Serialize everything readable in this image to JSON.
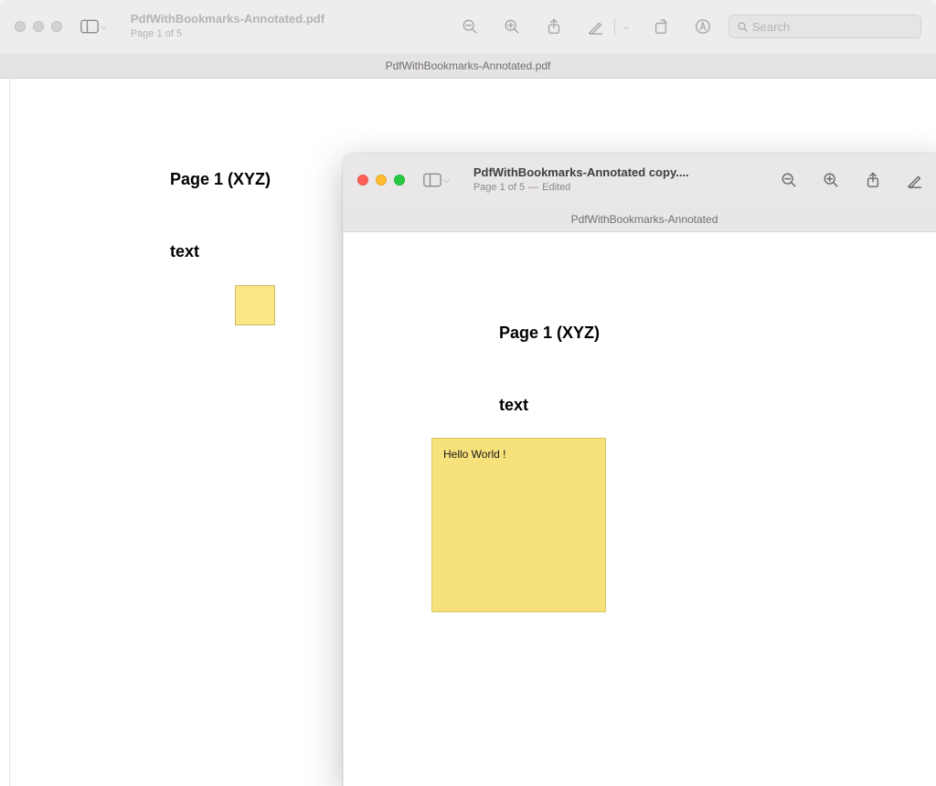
{
  "window1": {
    "title": "PdfWithBookmarks-Annotated.pdf",
    "page_indicator": "Page 1 of 5",
    "tab_label": "PdfWithBookmarks-Annotated.pdf",
    "search_placeholder": "Search",
    "content": {
      "heading": "Page 1 (XYZ)",
      "body": "text"
    }
  },
  "window2": {
    "title": "PdfWithBookmarks-Annotated copy....",
    "page_indicator": "Page 1 of 5",
    "edited_label": "Edited",
    "separator": " — ",
    "tab_label": "PdfWithBookmarks-Annotated",
    "content": {
      "heading": "Page 1 (XYZ)",
      "body": "text",
      "note_text": "Hello World !"
    }
  }
}
